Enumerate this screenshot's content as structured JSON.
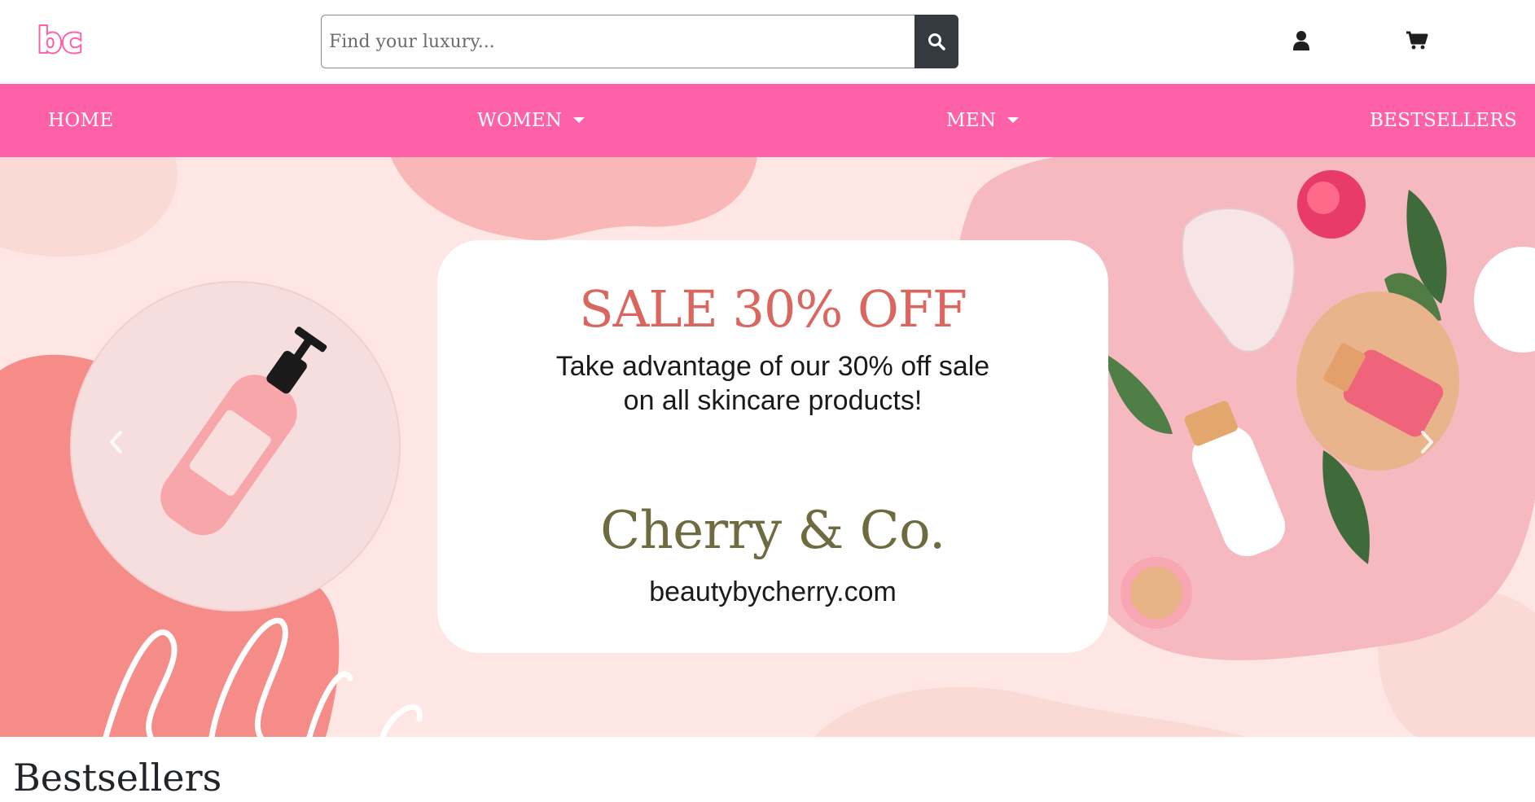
{
  "header": {
    "logo_text": "bc",
    "search": {
      "placeholder": "Find your luxury...",
      "value": ""
    },
    "search_button_icon": "search-icon",
    "user_icon": "user-icon",
    "cart_icon": "cart-icon"
  },
  "nav": {
    "items": [
      {
        "label": "HOME",
        "dropdown": false
      },
      {
        "label": "WOMEN",
        "dropdown": true
      },
      {
        "label": "MEN",
        "dropdown": true
      },
      {
        "label": "BESTSELLERS",
        "dropdown": false
      }
    ]
  },
  "hero": {
    "sale_title": "SALE 30% OFF",
    "sale_line1": "Take advantage of our 30% off sale",
    "sale_line2": "on all skincare products!",
    "brand_name": "Cherry & Co.",
    "brand_url": "beautybycherry.com",
    "prev_icon": "chevron-left-icon",
    "next_icon": "chevron-right-icon"
  },
  "sections": {
    "bestsellers_title": "Bestsellers"
  },
  "colors": {
    "nav_bg": "#ff61a8",
    "sale_title": "#d9675f",
    "brand_name": "#6d6b3f",
    "search_button": "#343a40"
  }
}
